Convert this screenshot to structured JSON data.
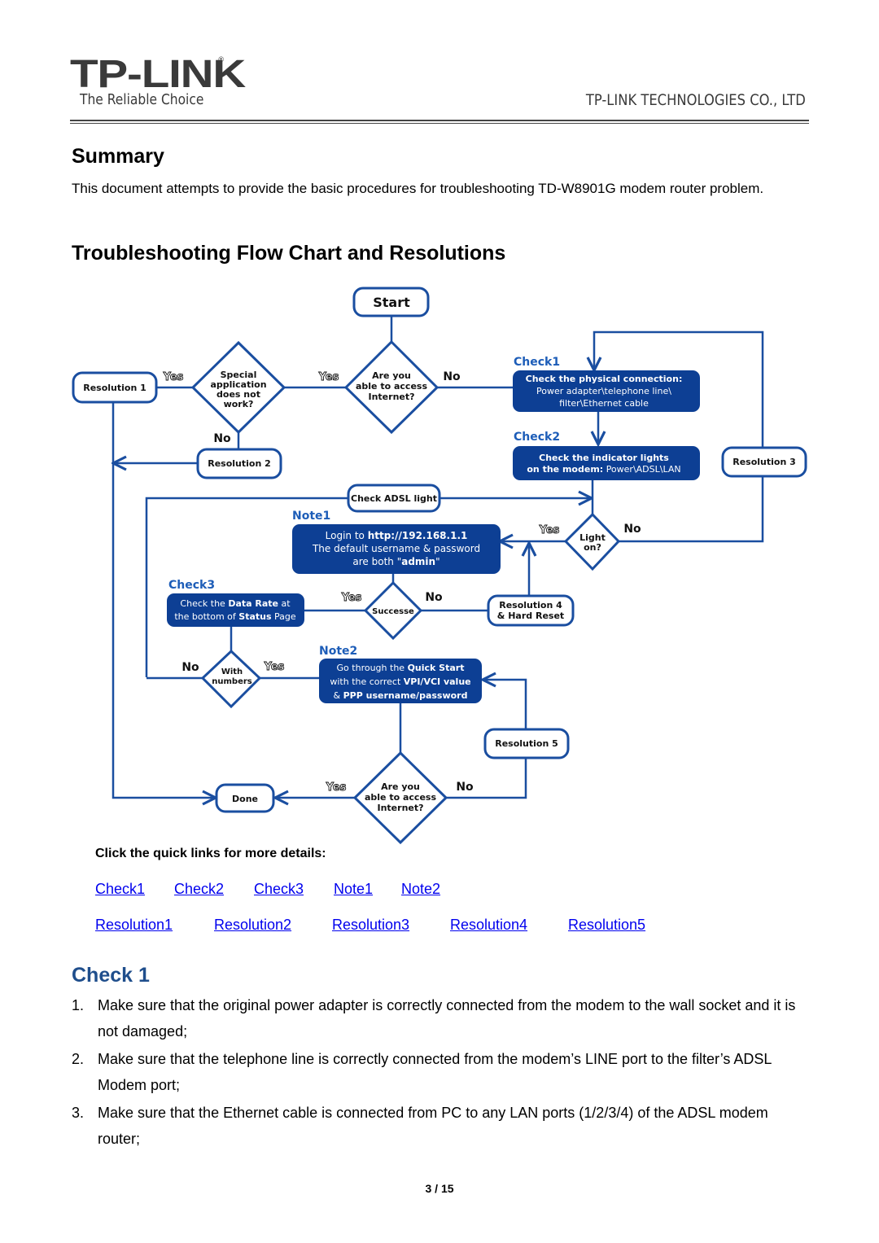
{
  "header": {
    "logo_text": "TP-LINK",
    "logo_mark": "®",
    "tagline": "The Reliable Choice",
    "company": "TP-LINK TECHNOLOGIES CO., LTD"
  },
  "summary": {
    "heading": "Summary",
    "text": "This document attempts to provide the basic procedures for troubleshooting TD-W8901G modem router problem."
  },
  "flowchart_section": {
    "heading": "Troubleshooting Flow Chart and Resolutions"
  },
  "colors": {
    "flow_blue": "#0d3f94",
    "line_blue": "#1a4ea0",
    "label_blue": "#1d5db8",
    "link_blue": "#0000ee",
    "check_heading": "#1f4e8c"
  },
  "flowchart": {
    "start": "Start",
    "q_access_1": [
      "Are you",
      "able to access",
      "Internet?"
    ],
    "q_special": [
      "Special",
      "application",
      "does not",
      "work?"
    ],
    "resolution1": "Resolution 1",
    "resolution2": "Resolution 2",
    "resolution3": "Resolution 3",
    "resolution4": [
      "Resolution 4",
      "& Hard Reset"
    ],
    "resolution5": "Resolution 5",
    "check1_label": "Check1",
    "check1_box": [
      "Check the physical connection:",
      "Power adapter\\telephone line\\",
      "filter\\Ethernet cable"
    ],
    "check2_label": "Check2",
    "check2_box": [
      "Check the indicator lights",
      "on the modem:",
      "Power\\ADSL\\LAN"
    ],
    "check_adsl": "Check ADSL light",
    "note1_label": "Note1",
    "note1_box": [
      "Login to ",
      "http://192.168.1.1",
      "The default username & password",
      "are both \"",
      "admin",
      "\""
    ],
    "q_light": [
      "Light",
      "on?"
    ],
    "check3_label": "Check3",
    "check3_box": [
      "Check the ",
      "Data Rate",
      " at",
      "the bottom of ",
      "Status",
      " Page"
    ],
    "q_success": "Successe",
    "q_numbers": [
      "With",
      "numbers"
    ],
    "note2_label": "Note2",
    "note2_box": [
      "Go through the ",
      "Quick Start",
      "with the correct ",
      "VPI/VCI value",
      "& ",
      "PPP username/password"
    ],
    "q_access_2": [
      "Are you",
      "able to access",
      "Internet?"
    ],
    "done": "Done",
    "yes": "Yes",
    "no": "No"
  },
  "quick_links": {
    "label": "Click the quick links for more details:",
    "row1": [
      "Check1",
      "Check2",
      "Check3",
      "Note1",
      "Note2"
    ],
    "row2": [
      "Resolution1",
      "Resolution2",
      "Resolution3",
      "Resolution4",
      "Resolution5"
    ]
  },
  "check1_section": {
    "heading": "Check 1",
    "steps": [
      {
        "num": "1.",
        "text": "Make sure that the original power adapter is correctly connected from the modem to the wall socket and it is not damaged;"
      },
      {
        "num": "2.",
        "text": "Make sure that the telephone line is correctly connected from the modem’s LINE port to the filter’s ADSL Modem port;"
      },
      {
        "num": "3.",
        "text": "Make sure that the Ethernet cable is connected from PC to any LAN ports (1/2/3/4) of the ADSL modem router;"
      }
    ]
  },
  "footer": {
    "page": "3 / 15"
  }
}
